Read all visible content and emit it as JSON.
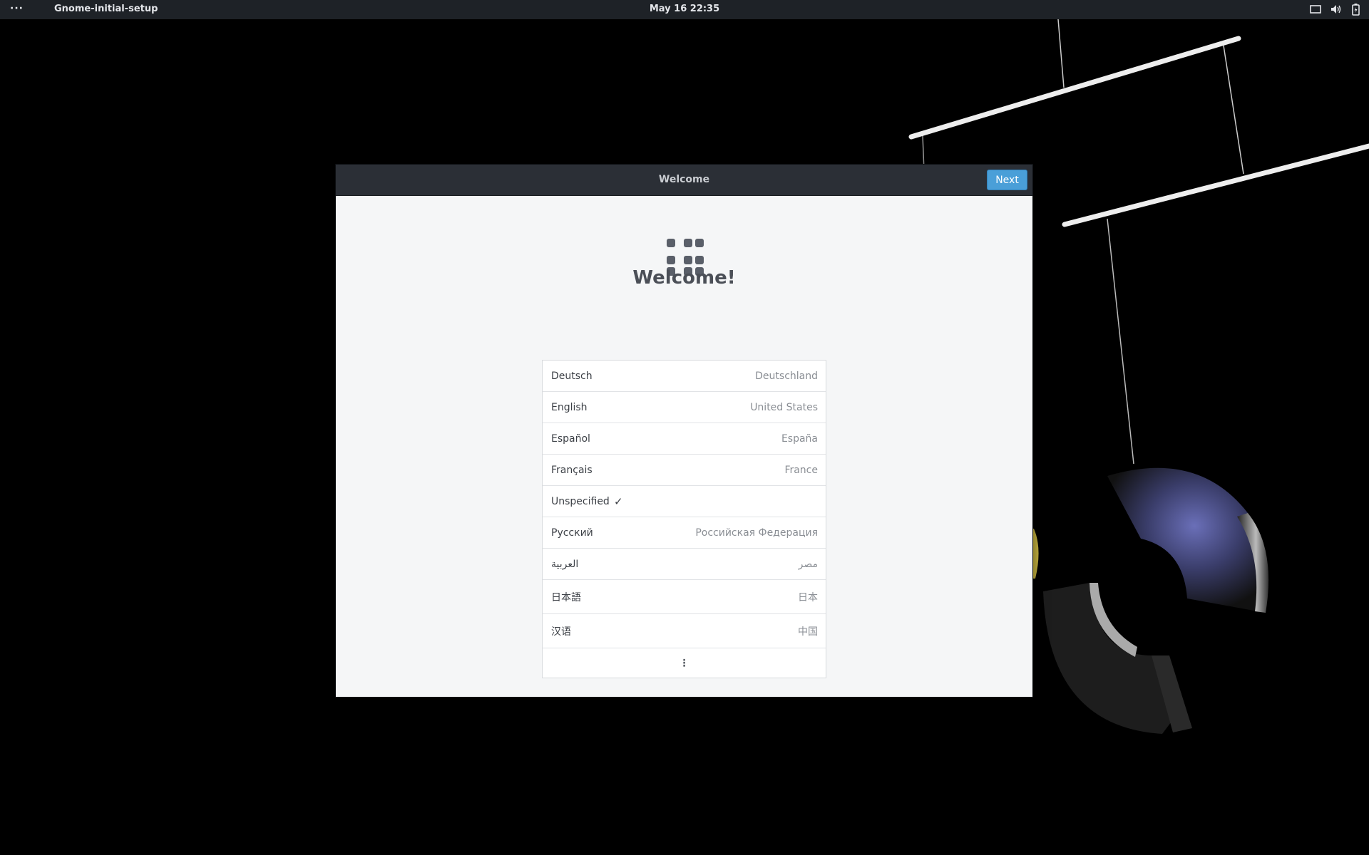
{
  "topbar": {
    "activities": "···",
    "app_name": "Gnome-initial-setup",
    "clock": "May 16  22:35",
    "tray_icons": [
      "display-icon",
      "volume-icon",
      "battery-icon"
    ]
  },
  "window": {
    "title": "Welcome",
    "next_label": "Next",
    "heading": "Welcome!",
    "icon": "app-grid-icon",
    "languages": [
      {
        "name": "Deutsch",
        "region": "Deutschland"
      },
      {
        "name": "English",
        "region": "United States"
      },
      {
        "name": "Español",
        "region": "España"
      },
      {
        "name": "Français",
        "region": "France"
      },
      {
        "name": "Unspecified",
        "region": "",
        "selected": true,
        "check": "✓"
      },
      {
        "name": "Русский",
        "region": "Российская Федерация"
      },
      {
        "name": "العربية",
        "region": "مصر"
      },
      {
        "name": "日本語",
        "region": "日本"
      },
      {
        "name": "汉语",
        "region": "中国"
      }
    ],
    "more_label": "⋮"
  },
  "colors": {
    "topbar": "#1e2227",
    "headerbar": "#2b2f36",
    "accent": "#4a9fd8",
    "content_bg": "#f5f6f7"
  }
}
